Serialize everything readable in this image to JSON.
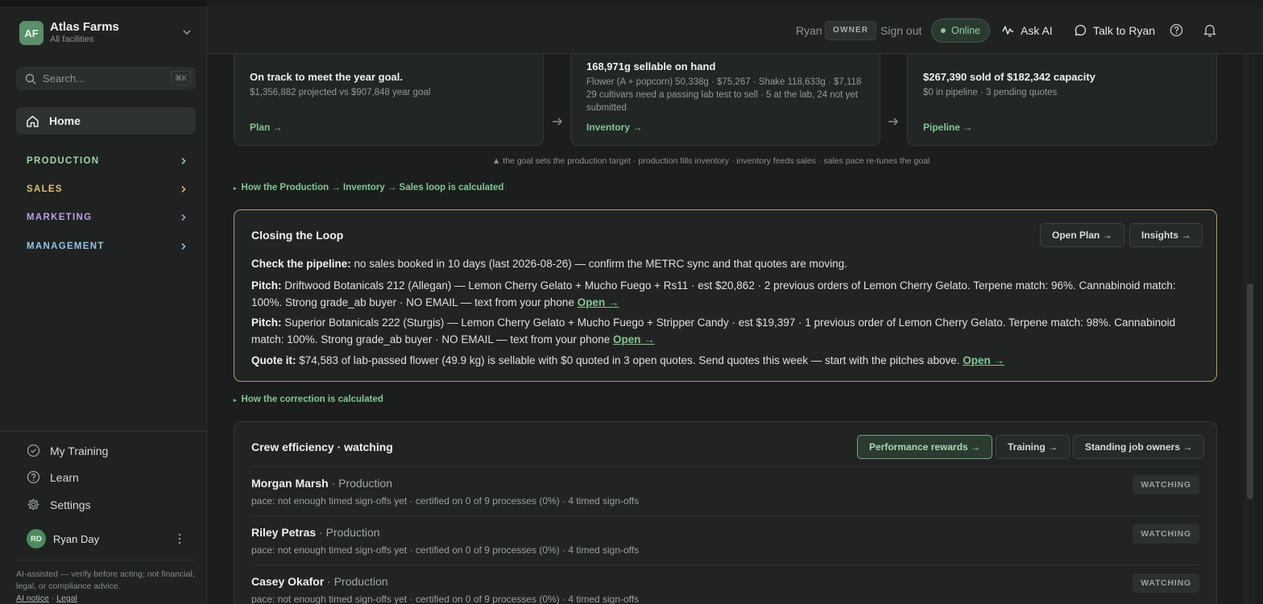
{
  "sidebar": {
    "brand": {
      "initials": "AF",
      "name": "Atlas Farms",
      "subtitle": "All facilities"
    },
    "search": {
      "placeholder": "Search...",
      "shortcut": "⌘K"
    },
    "home_label": "Home",
    "sections": [
      {
        "label": "PRODUCTION",
        "color": "#9fd3a9"
      },
      {
        "label": "SALES",
        "color": "#e3c16f"
      },
      {
        "label": "MARKETING",
        "color": "#b9a3e6"
      },
      {
        "label": "MANAGEMENT",
        "color": "#8fc6e6"
      }
    ],
    "bottom_items": [
      {
        "label": "My Training",
        "icon": "check-circle-icon"
      },
      {
        "label": "Learn",
        "icon": "help-circle-icon"
      },
      {
        "label": "Settings",
        "icon": "gear-icon"
      }
    ],
    "user": {
      "initials": "RD",
      "name": "Ryan Day"
    },
    "disclaimer": {
      "text": "AI-assisted — verify before acting; not financial, legal, or compliance advice.",
      "link1": "AI notice",
      "sep": "·",
      "link2": "Legal"
    }
  },
  "topbar": {
    "user_name": "Ryan",
    "role_badge": "OWNER",
    "sign_out": "Sign out",
    "status": "Online",
    "ask_ai": "Ask AI",
    "talk": "Talk to Ryan"
  },
  "summary_cards": [
    {
      "progress": 1.0,
      "title": "On track to meet the year goal.",
      "lines": [
        "$1,356,882 projected vs $907,848 year goal"
      ],
      "link": "Plan →"
    },
    {
      "progress": null,
      "title": "168,971g sellable on hand",
      "lines": [
        "Flower (A + popcorn) 50,338g · $75,267  ·  Shake 118,633g · $7,118",
        "29 cultivars need a passing lab test to sell · 5 at the lab, 24 not yet submitted"
      ],
      "link": "Inventory →"
    },
    {
      "progress": 1.0,
      "title": "$267,390 sold of $182,342 capacity",
      "lines": [
        "$0 in pipeline · 3 pending quotes"
      ],
      "link": "Pipeline →"
    }
  ],
  "loop_note": "▲ the goal sets the production target · production fills inventory · inventory feeds sales · sales pace re-tunes the goal",
  "calc_link_1": "How the Production → Inventory → Sales loop is calculated",
  "closing_loop": {
    "title": "Closing the Loop",
    "buttons": [
      "Open Plan →",
      "Insights →"
    ],
    "items": [
      {
        "label": "Check the pipeline:",
        "text": " no sales booked in 10 days (last 2026-08-26) — confirm the METRC sync and that quotes are moving.",
        "link": ""
      },
      {
        "label": "Pitch:",
        "text": " Driftwood Botanicals 212 (Allegan) — Lemon Cherry Gelato + Mucho Fuego + Rs11 · est $20,862 · 2 previous orders of Lemon Cherry Gelato. Terpene match: 96%. Cannabinoid match: 100%. Strong grade_ab buyer · NO EMAIL — text from your phone ",
        "link": "Open →"
      },
      {
        "label": "Pitch:",
        "text": " Superior Botanicals 222 (Sturgis) — Lemon Cherry Gelato + Mucho Fuego + Stripper Candy · est $19,397 · 1 previous order of Lemon Cherry Gelato. Terpene match: 98%. Cannabinoid match: 100%. Strong grade_ab buyer · NO EMAIL — text from your phone ",
        "link": "Open →"
      },
      {
        "label": "Quote it:",
        "text": " $74,583 of lab-passed flower (49.9 kg) is sellable with $0 quoted in 3 open quotes. Send quotes this week — start with the pitches above. ",
        "link": "Open →"
      }
    ]
  },
  "calc_link_2": "How the correction is calculated",
  "crew": {
    "title": "Crew efficiency · watching",
    "buttons": [
      "Performance rewards →",
      "Training →",
      "Standing job owners →"
    ],
    "rows": [
      {
        "name": "Morgan Marsh",
        "dept": " · Production",
        "pace": "pace: not enough timed sign-offs yet · certified on 0 of 9 processes (0%) · 4 timed sign-offs",
        "badge": "WATCHING"
      },
      {
        "name": "Riley Petras",
        "dept": " · Production",
        "pace": "pace: not enough timed sign-offs yet · certified on 0 of 9 processes (0%) · 4 timed sign-offs",
        "badge": "WATCHING"
      },
      {
        "name": "Casey Okafor",
        "dept": " · Production",
        "pace": "pace: not enough timed sign-offs yet · certified on 0 of 9 processes (0%) · 4 timed sign-offs",
        "badge": "WATCHING"
      }
    ]
  }
}
